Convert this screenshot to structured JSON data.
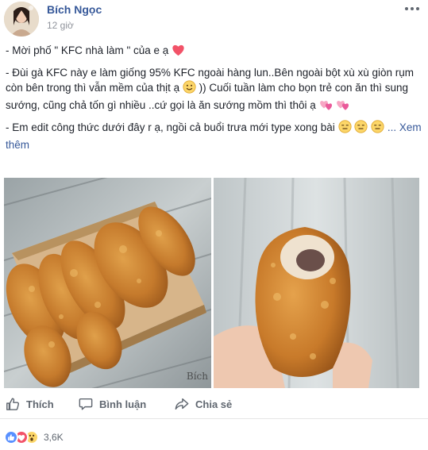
{
  "post": {
    "author": "Bích Ngọc",
    "time": "12 giờ",
    "more_label": "•••",
    "paragraphs": [
      {
        "text": "- Mời phố \" KFC nhà làm \" của e ạ",
        "emoji": [
          "heart"
        ]
      },
      {
        "text": "- Đùi gà KFC này e làm giống 95% KFC ngoài hàng lun..Bên ngoài bột xù xù giòn rụm còn bên trong thì vẫn mềm của thịt ạ",
        "emoji_mid": "smile",
        "text2": ")) Cuối tuần làm cho bọn trẻ con ăn thì sung sướng, cũng chả tốn gì nhiều ..cứ gọi là ăn sướng mồm thì thôi ạ",
        "emoji": [
          "two-hearts",
          "two-hearts"
        ]
      },
      {
        "text": "- Em edit công thức dưới đây r ạ, ngồi cả buổi trưa mới type xong bài",
        "emoji": [
          "expressionless",
          "expressionless",
          "expressionless"
        ]
      }
    ],
    "see_more": "... Xem thêm",
    "photo_watermark": "Bích"
  },
  "actions": {
    "like": "Thích",
    "comment": "Bình luận",
    "share": "Chia sẻ"
  },
  "reactions": {
    "types": [
      "like",
      "love",
      "wow"
    ],
    "count": "3,6K"
  },
  "colors": {
    "link": "#365899",
    "text": "#1d2129",
    "muted": "#90949c",
    "like_blue": "#5890ff",
    "love_red": "#f25268",
    "wow_yellow": "#fcd669"
  }
}
